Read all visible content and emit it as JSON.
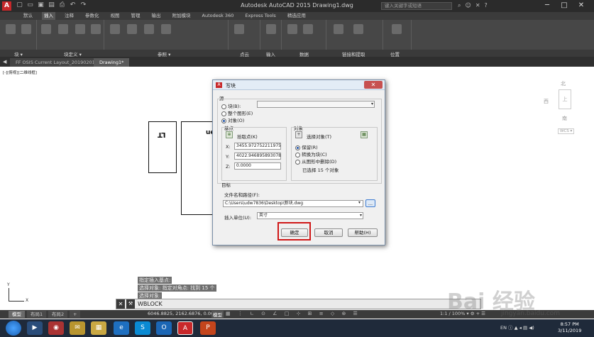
{
  "window": {
    "title": "Autodesk AutoCAD 2015    Drawing1.dwg",
    "search_placeholder": "键入关键字或短语",
    "min": "─",
    "max": "□",
    "close": "✕"
  },
  "ribbon_tabs": [
    "默认",
    "插入",
    "注释",
    "参数化",
    "视图",
    "管理",
    "输出",
    "附加模块",
    "Autodesk 360",
    "Express Tools",
    "精选应用"
  ],
  "ribbon_active_tab": "插入",
  "ribbon_panels": [
    "块 ▾",
    "块定义 ▾",
    "参照 ▾",
    "点云",
    "输入",
    "数据",
    "链接和提取",
    "位置"
  ],
  "file_tabs": [
    "FF OSIS Current Layout_20190201*",
    "Drawing1*"
  ],
  "view_label": "[-][俯视][二维线框]",
  "drawing": {
    "text1": "LT",
    "text2": "ued"
  },
  "viewcube": {
    "north": "北",
    "west": "西",
    "south": "南",
    "top_face": "上",
    "wcs": "WCS ▾"
  },
  "dialog": {
    "title": "写块",
    "close": "✕",
    "source_label": "源",
    "source_block": "块(B):",
    "source_entire": "整个图形(E)",
    "source_objects": "对象(O)",
    "basepoint_label": "基点",
    "pick_point": "拾取点(K)",
    "x_label": "X:",
    "x_value": "3455.972752211975",
    "y_label": "Y:",
    "y_value": "4022.946895893078",
    "z_label": "Z:",
    "z_value": "0.0000",
    "objects_label": "对象",
    "select_objects": "选择对象(T)",
    "retain": "保留(R)",
    "convert": "转换为块(C)",
    "delete": "从图形中删除(D)",
    "selected_count": "已选择 15 个对象",
    "target_label": "目标",
    "filename_label": "文件名和路径(F):",
    "filename_value": "C:\\Users\\udw7836\\Desktop\\新块.dwg",
    "browse": "...",
    "units_label": "插入单位(U):",
    "units_value": "英寸",
    "ok": "确定",
    "cancel": "取消",
    "help": "帮助(H)"
  },
  "command_history": [
    "指定插入基点:",
    "选择对象: 指定对角点: 找到 15 个",
    "选择对象:"
  ],
  "command_line": "WBLOCK",
  "ucs": {
    "x": "X",
    "y": "Y"
  },
  "layout_tabs": [
    "模型",
    "布局1",
    "布局2",
    "+"
  ],
  "status": {
    "coords": "6046.8825, 2162.6876, 0.0000",
    "model": "模型",
    "icons": "▦ ⋮ ∟ ⊙ ∠ □ ⊹ ⊞ ≡ ◇ ⊛ ☰",
    "scale": "1:1 / 100% ▾  ⚙  +  ☰"
  },
  "taskbar": {
    "apps": [
      "▶",
      "◉",
      "✉",
      "▦",
      "e",
      "S",
      "O",
      "A",
      "P"
    ],
    "tray": "EN ⓘ ▲ ◂ ▤ ◀)",
    "time": "8:57 PM",
    "date": "3/11/2019"
  },
  "watermark": {
    "logo": "Bai  经验",
    "url": "jingyan.baidu.com"
  },
  "colors": {
    "accent_red": "#d01818",
    "autocad_red": "#c8282a",
    "ribbon_bg": "#474747",
    "taskbar_bg": "#1f2a3a"
  }
}
